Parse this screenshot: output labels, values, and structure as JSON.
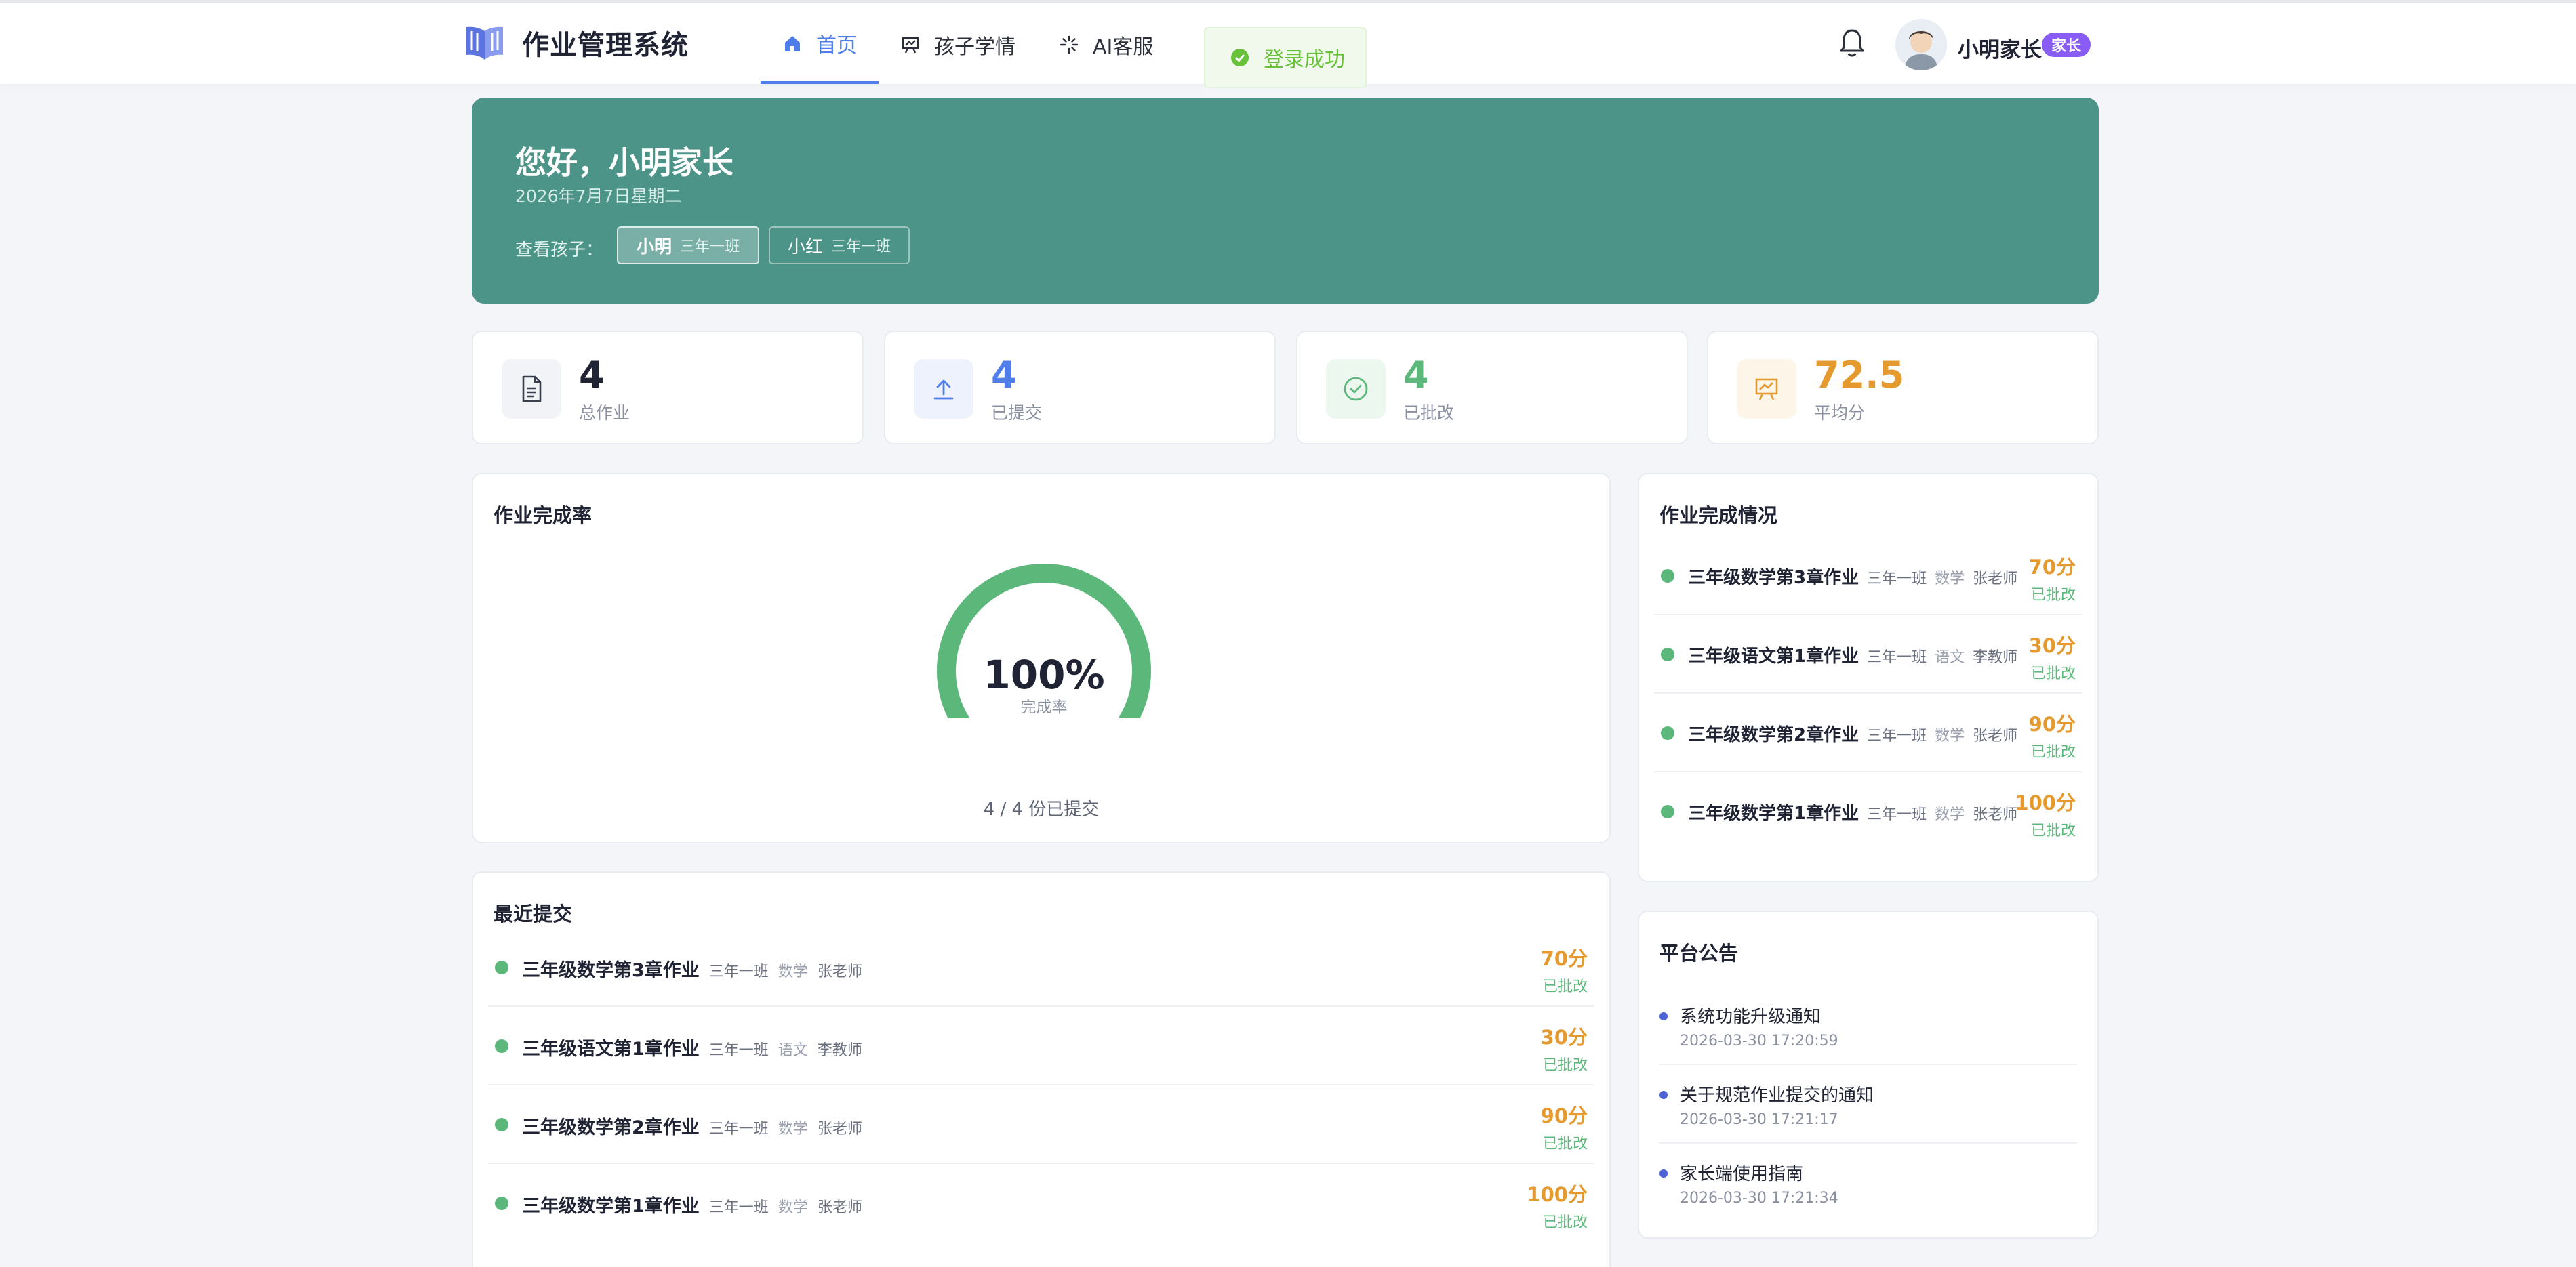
{
  "app": {
    "title": "作业管理系统"
  },
  "nav": [
    {
      "label": "首页",
      "icon": "home-icon",
      "active": true
    },
    {
      "label": "孩子学情",
      "icon": "presentation-chart-icon",
      "active": false
    },
    {
      "label": "AI客服",
      "icon": "sparkle-icon",
      "active": false
    }
  ],
  "toast": {
    "text": "登录成功"
  },
  "user": {
    "name": "小明家长",
    "role": "家长"
  },
  "banner": {
    "greeting": "您好，小明家长",
    "date": "2026年7月7日星期二",
    "child_label": "查看孩子：",
    "children": [
      {
        "name": "小明",
        "class": "三年一班",
        "active": true
      },
      {
        "name": "小红",
        "class": "三年一班",
        "active": false
      }
    ]
  },
  "stats": [
    {
      "value": "4",
      "label": "总作业",
      "icon": "document-icon",
      "color": "#1f2333",
      "icon_bg": "#f1f3f7"
    },
    {
      "value": "4",
      "label": "已提交",
      "icon": "upload-icon",
      "color": "#4f7de9",
      "icon_bg": "#edf2fd"
    },
    {
      "value": "4",
      "label": "已批改",
      "icon": "check-circle-icon",
      "color": "#5cb87a",
      "icon_bg": "#ecf7f0"
    },
    {
      "value": "72.5",
      "label": "平均分",
      "icon": "presentation-chart-icon",
      "color": "#e59a2f",
      "icon_bg": "#fdf6e8"
    }
  ],
  "completion": {
    "title": "作业完成率",
    "percent_text": "100%",
    "percent": 100,
    "caption": "完成率",
    "footer": "4 / 4 份已提交"
  },
  "status_panel": {
    "title": "作业完成情况",
    "items": [
      {
        "title": "三年级数学第3章作业",
        "class": "三年一班",
        "subject": "数学",
        "teacher": "张老师",
        "score": "70分",
        "status": "已批改"
      },
      {
        "title": "三年级语文第1章作业",
        "class": "三年一班",
        "subject": "语文",
        "teacher": "李教师",
        "score": "30分",
        "status": "已批改"
      },
      {
        "title": "三年级数学第2章作业",
        "class": "三年一班",
        "subject": "数学",
        "teacher": "张老师",
        "score": "90分",
        "status": "已批改"
      },
      {
        "title": "三年级数学第1章作业",
        "class": "三年一班",
        "subject": "数学",
        "teacher": "张老师",
        "score": "100分",
        "status": "已批改"
      }
    ]
  },
  "recent": {
    "title": "最近提交",
    "items": [
      {
        "title": "三年级数学第3章作业",
        "class": "三年一班",
        "subject": "数学",
        "teacher": "张老师",
        "score": "70分",
        "status": "已批改"
      },
      {
        "title": "三年级语文第1章作业",
        "class": "三年一班",
        "subject": "语文",
        "teacher": "李教师",
        "score": "30分",
        "status": "已批改"
      },
      {
        "title": "三年级数学第2章作业",
        "class": "三年一班",
        "subject": "数学",
        "teacher": "张老师",
        "score": "90分",
        "status": "已批改"
      },
      {
        "title": "三年级数学第1章作业",
        "class": "三年一班",
        "subject": "数学",
        "teacher": "张老师",
        "score": "100分",
        "status": "已批改"
      }
    ]
  },
  "notices": {
    "title": "平台公告",
    "items": [
      {
        "title": "系统功能升级通知",
        "time": "2026-03-30 17:20:59"
      },
      {
        "title": "关于规范作业提交的通知",
        "time": "2026-03-30 17:21:17"
      },
      {
        "title": "家长端使用指南",
        "time": "2026-03-30 17:21:34"
      }
    ]
  }
}
